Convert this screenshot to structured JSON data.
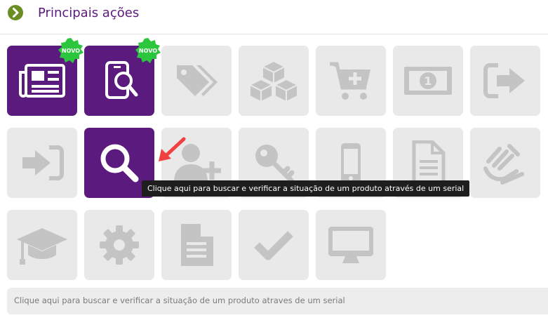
{
  "header": {
    "title": "Principais ações",
    "icon": "chevron-right-circle-icon"
  },
  "colors": {
    "accent": "#5b1a7d",
    "tile_inactive": "#e9e9e9",
    "icon_inactive": "#c4c4c4",
    "badge": "#2cc53e",
    "arrow": "#f04040"
  },
  "tiles": [
    {
      "icon": "newspaper-icon",
      "active": true,
      "badge": "NOVO"
    },
    {
      "icon": "mobile-search-icon",
      "active": true,
      "badge": "NOVO"
    },
    {
      "icon": "tags-icon",
      "active": false
    },
    {
      "icon": "cubes-icon",
      "active": false
    },
    {
      "icon": "cart-plus-icon",
      "active": false
    },
    {
      "icon": "money-icon",
      "active": false
    },
    {
      "icon": "sign-out-icon",
      "active": false
    },
    {
      "icon": "sign-in-icon",
      "active": false
    },
    {
      "icon": "search-icon",
      "active": true
    },
    {
      "icon": "user-plus-icon",
      "active": false
    },
    {
      "icon": "key-icon",
      "active": false
    },
    {
      "icon": "mobile-phone-icon",
      "active": false
    },
    {
      "icon": "document-icon",
      "active": false
    },
    {
      "icon": "sign-language-icon",
      "active": false
    },
    {
      "icon": "graduation-cap-icon",
      "active": false
    },
    {
      "icon": "gear-icon",
      "active": false
    },
    {
      "icon": "file-text-icon",
      "active": false
    },
    {
      "icon": "check-icon",
      "active": false
    },
    {
      "icon": "monitor-icon",
      "active": false
    }
  ],
  "tooltip": {
    "text": "Clique aqui para buscar e verificar a situação de um produto através de um serial"
  },
  "status_bar": {
    "text": "Clique aqui para buscar e verificar a situação de um produto atraves de um serial"
  }
}
